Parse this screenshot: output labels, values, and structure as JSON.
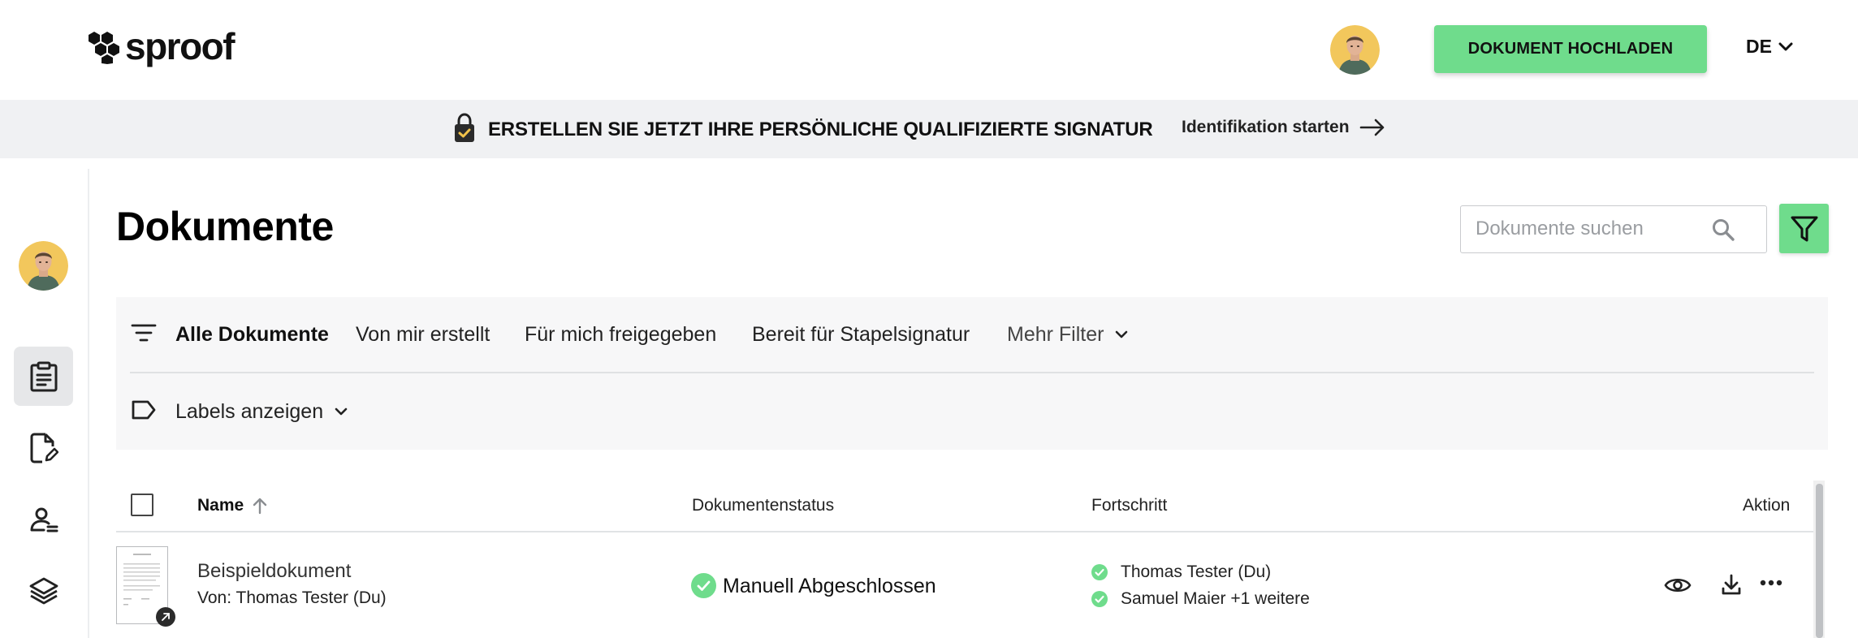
{
  "header": {
    "logo_text": "sproof",
    "upload_button": "DOKUMENT HOCHLADEN",
    "language": "DE"
  },
  "banner": {
    "text": "ERSTELLEN SIE JETZT IHRE PERSÖNLICHE QUALIFIZIERTE SIGNATUR",
    "link": "Identifikation starten"
  },
  "sidebar": {
    "items": [
      {
        "icon": "clipboard-icon",
        "active": true
      },
      {
        "icon": "document-edit-icon",
        "active": false
      },
      {
        "icon": "contacts-icon",
        "active": false
      },
      {
        "icon": "layers-icon",
        "active": false
      }
    ]
  },
  "main": {
    "title": "Dokumente",
    "search_placeholder": "Dokumente suchen",
    "tabs": [
      {
        "label": "Alle Dokumente",
        "active": true
      },
      {
        "label": "Von mir erstellt",
        "active": false
      },
      {
        "label": "Für mich freigegeben",
        "active": false
      },
      {
        "label": "Bereit für Stapelsignatur",
        "active": false
      },
      {
        "label": "Mehr Filter",
        "active": false
      }
    ],
    "labels_toggle": "Labels anzeigen"
  },
  "table": {
    "columns": {
      "name": "Name",
      "status": "Dokumentenstatus",
      "progress": "Fortschritt",
      "action": "Aktion"
    },
    "rows": [
      {
        "name": "Beispieldokument",
        "owner": "Von: Thomas Tester (Du)",
        "status": "Manuell Abgeschlossen",
        "progress": [
          "Thomas Tester (Du)",
          "Samuel Maier +1 weitere"
        ]
      }
    ]
  },
  "colors": {
    "accent": "#6fdc8c",
    "banner_bg": "#f0f1f3",
    "panel_bg": "#f7f7f8"
  }
}
